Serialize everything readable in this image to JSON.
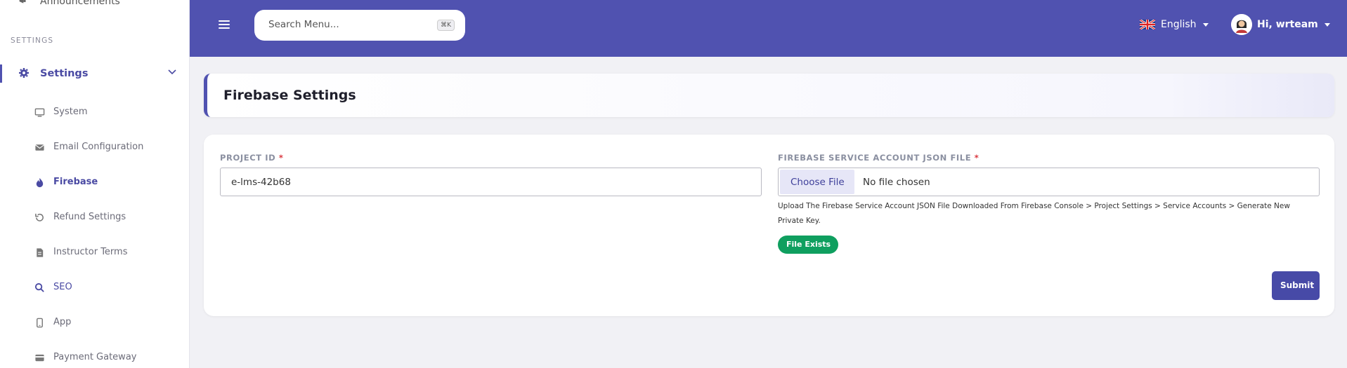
{
  "sidebar": {
    "top_item": {
      "label": "Announcements",
      "icon": "megaphone-icon"
    },
    "section_heading": "SETTINGS",
    "settings": {
      "label": "Settings",
      "icon": "gear-icon"
    },
    "items": [
      {
        "label": "System",
        "icon": "monitor-icon"
      },
      {
        "label": "Email Configuration",
        "icon": "envelope-icon"
      },
      {
        "label": "Firebase",
        "icon": "flame-icon",
        "active": true
      },
      {
        "label": "Refund Settings",
        "icon": "refund-icon"
      },
      {
        "label": "Instructor Terms",
        "icon": "document-icon"
      },
      {
        "label": "SEO",
        "icon": "search-icon"
      },
      {
        "label": "App",
        "icon": "mobile-icon"
      },
      {
        "label": "Payment Gateway",
        "icon": "card-icon"
      }
    ]
  },
  "header": {
    "search_placeholder": "Search Menu...",
    "shortcut": "⌘K",
    "language": "English",
    "user_greeting": "Hi, wrteam"
  },
  "page": {
    "title": "Firebase Settings"
  },
  "form": {
    "project_id_label": "PROJECT ID",
    "required_mark": "*",
    "project_id_value": "e-lms-42b68",
    "json_file_label": "FIREBASE SERVICE ACCOUNT JSON FILE",
    "choose_file_label": "Choose File",
    "no_file_text": "No file chosen",
    "help_text": "Upload The Firebase Service Account JSON File Downloaded From Firebase Console > Project Settings > Service Accounts > Generate New Private Key.",
    "file_status": "File Exists",
    "submit_label": "Submit"
  },
  "colors": {
    "primary": "#5052b0",
    "success": "#0f9f5f",
    "required": "#d9363e"
  }
}
